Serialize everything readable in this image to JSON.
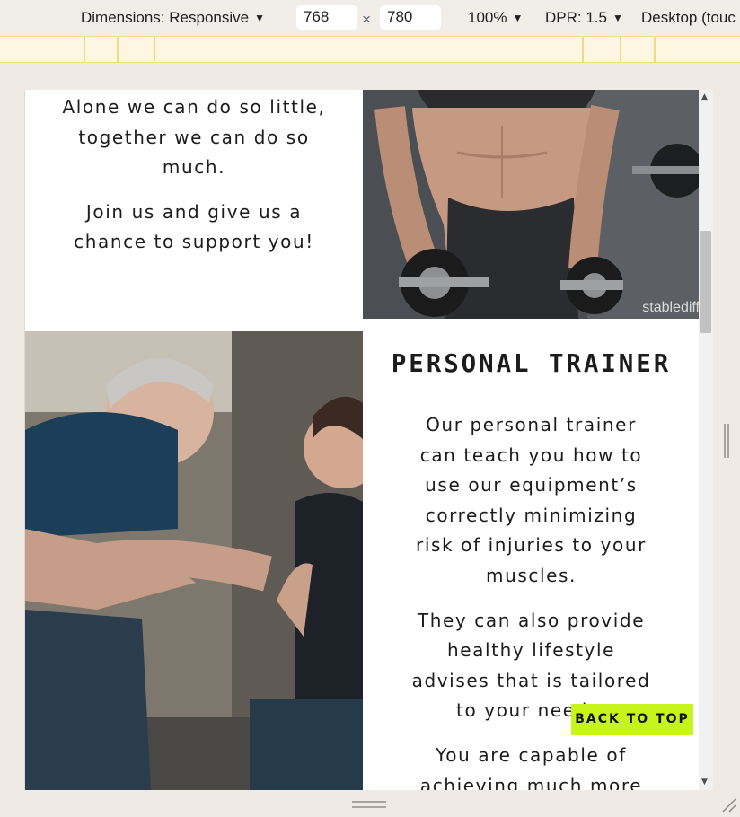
{
  "toolbar": {
    "dimensions_label": "Dimensions: Responsive",
    "width_value": "768",
    "height_value": "780",
    "times": "×",
    "zoom": "100%",
    "dpr": "DPR: 1.5",
    "device_mode": "Desktop (touc"
  },
  "page": {
    "quote_lines": [
      "Alone we can do so little, together we can do so much.",
      "Join us and give us a chance to support you!"
    ],
    "abs_photo_watermark": "stablediff",
    "personal_trainer": {
      "title": "PERSONAL TRAINER",
      "paragraphs": [
        "Our personal trainer can teach you how to use our equipment’s correctly minimizing risk of injuries to your muscles.",
        "They can also provide healthy lifestyle advises that is tailored to your needs.",
        "You are capable of achieving much more"
      ]
    },
    "back_to_top_label": "BACK TO TOP",
    "accent_color": "#c6f41b"
  }
}
